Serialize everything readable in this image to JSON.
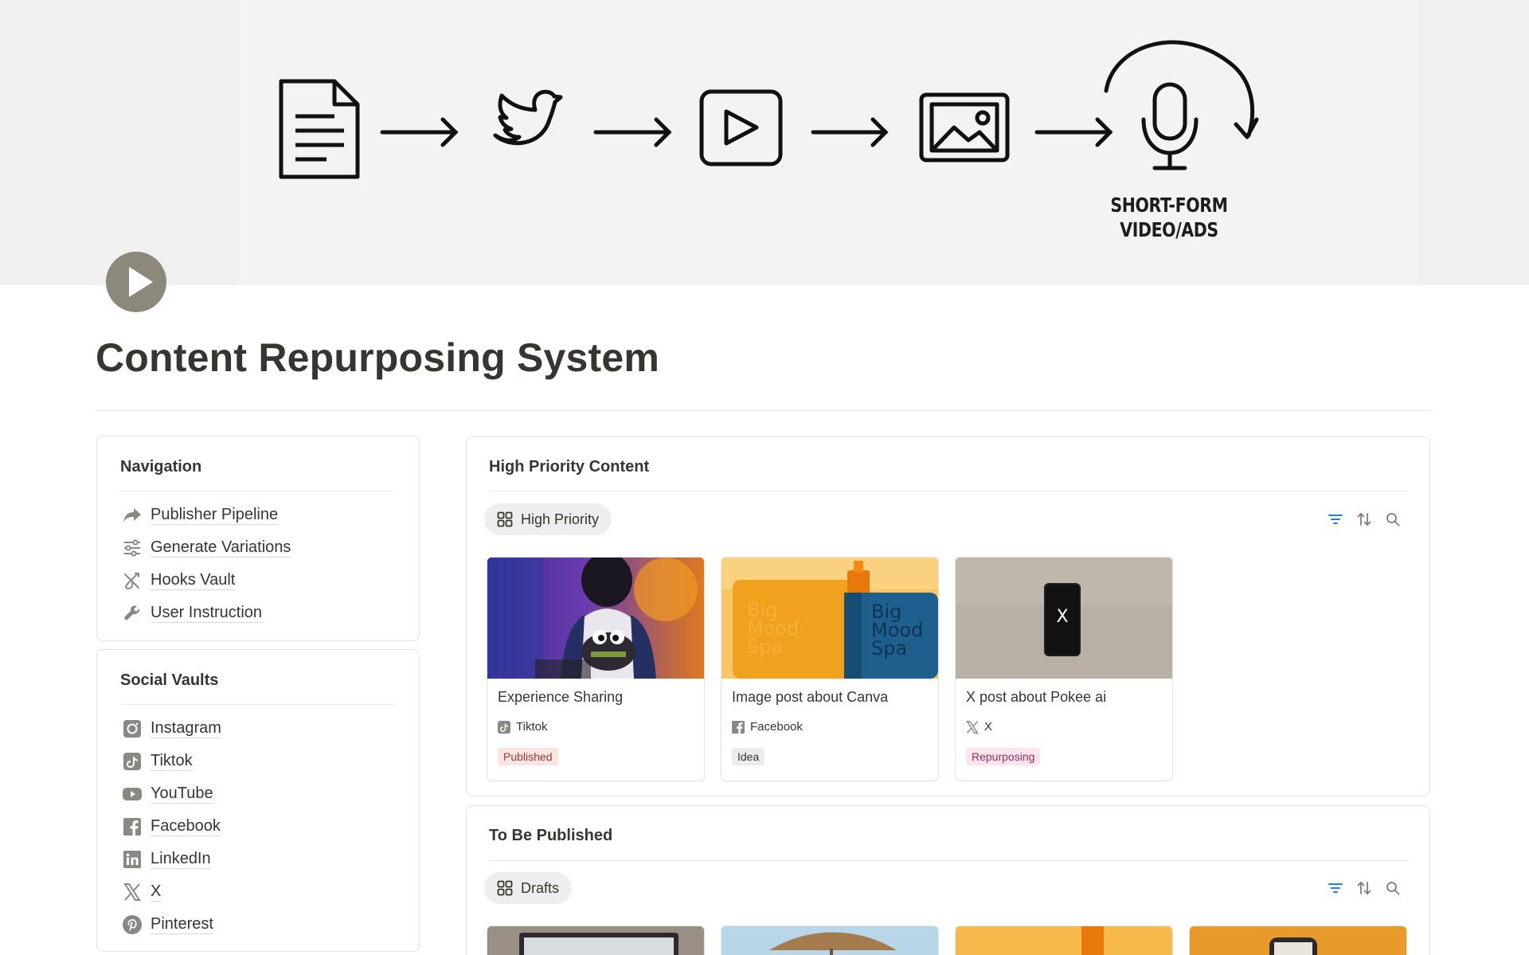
{
  "cover": {
    "flow_steps": [
      "document-icon",
      "twitter-bird-icon",
      "play-video-icon",
      "image-icon",
      "microphone-icon"
    ],
    "label_line1": "SHORT-FORM",
    "label_line2": "VIDEO/ADS"
  },
  "page": {
    "icon": "play-circle-icon",
    "title": "Content Repurposing System"
  },
  "navigation": {
    "heading": "Navigation",
    "items": [
      {
        "label": "Publisher Pipeline",
        "icon": "share-arrow-icon"
      },
      {
        "label": "Generate Variations",
        "icon": "sliders-icon"
      },
      {
        "label": "Hooks Vault",
        "icon": "hook-icon"
      },
      {
        "label": "User Instruction",
        "icon": "wrench-icon"
      }
    ]
  },
  "social_vaults": {
    "heading": "Social Vaults",
    "items": [
      {
        "label": "Instagram",
        "icon": "instagram-icon"
      },
      {
        "label": "Tiktok",
        "icon": "tiktok-icon"
      },
      {
        "label": "YouTube",
        "icon": "youtube-icon"
      },
      {
        "label": "Facebook",
        "icon": "facebook-icon"
      },
      {
        "label": "LinkedIn",
        "icon": "linkedin-icon"
      },
      {
        "label": "X",
        "icon": "x-icon"
      },
      {
        "label": "Pinterest",
        "icon": "pinterest-icon"
      }
    ]
  },
  "high_priority": {
    "heading": "High Priority Content",
    "view_label": "High Priority",
    "tools": [
      "filter-icon",
      "sort-icon",
      "search-icon"
    ],
    "cards": [
      {
        "title": "Experience Sharing",
        "platform": "Tiktok",
        "platform_icon": "tiktok-icon",
        "status": "Published",
        "status_bg": "#fbe4e4",
        "status_fg": "#9f3a2b"
      },
      {
        "title": "Image post about Canva",
        "platform": "Facebook",
        "platform_icon": "facebook-icon",
        "status": "Idea",
        "status_bg": "#ebeced",
        "status_fg": "#37352f"
      },
      {
        "title": "X post about Pokee ai",
        "platform": "X",
        "platform_icon": "x-icon",
        "status": "Repurposing",
        "status_bg": "#fbe4ec",
        "status_fg": "#9c2f5b"
      }
    ],
    "canva_art_text": [
      "Big",
      "Mood",
      "Spa"
    ],
    "x_phone_text": "X"
  },
  "to_be_published": {
    "heading": "To Be Published",
    "view_label": "Drafts",
    "tools": [
      "filter-icon",
      "sort-icon",
      "search-icon"
    ]
  },
  "colors": {
    "text": "#37352f",
    "accent_blue": "#2383e2",
    "icon_gray": "#7d7c78"
  }
}
